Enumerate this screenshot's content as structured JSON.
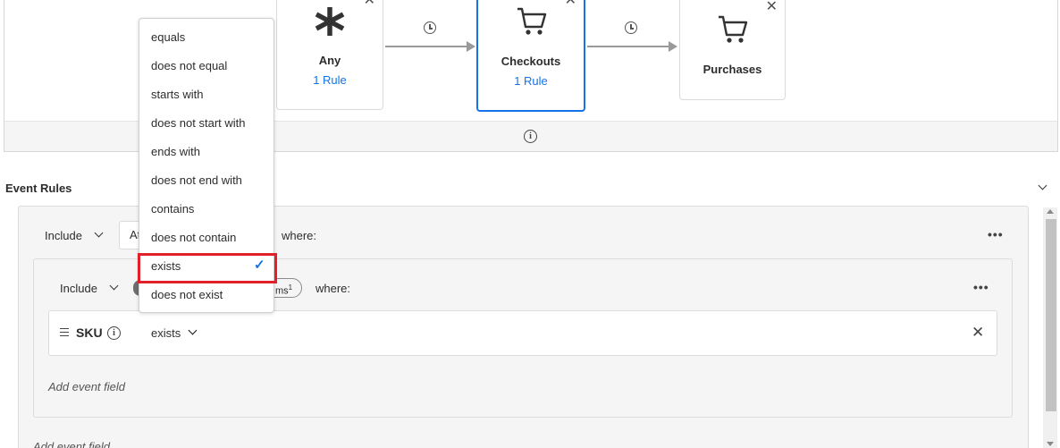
{
  "flow": {
    "nodes": [
      {
        "title": "Any",
        "rule": "1 Rule",
        "icon": "asterisk-icon"
      },
      {
        "title": "Checkouts",
        "rule": "1 Rule",
        "icon": "cart-icon",
        "selected": true
      },
      {
        "title": "Purchases",
        "icon": "cart-icon"
      }
    ],
    "close_glyph": "✕",
    "info_glyph": "i"
  },
  "event_rules": {
    "title": "Event Rules",
    "outer": {
      "include": "Include",
      "partial": "At",
      "where": "where:"
    },
    "inner": {
      "include": "Include",
      "partial_badge": "ms",
      "badge_sup": "1",
      "where": "where:"
    },
    "sku": {
      "label": "SKU",
      "operator": "exists"
    },
    "add_event_field": "Add event field",
    "add_event_field_bottom": "Add event field"
  },
  "operator_menu": {
    "items": [
      {
        "label": "equals"
      },
      {
        "label": "does not equal"
      },
      {
        "label": "starts with"
      },
      {
        "label": "does not start with"
      },
      {
        "label": "ends with"
      },
      {
        "label": "does not end with"
      },
      {
        "label": "contains"
      },
      {
        "label": "does not contain"
      },
      {
        "label": "exists",
        "selected": true
      },
      {
        "label": "does not exist"
      }
    ],
    "check_glyph": "✓"
  },
  "colors": {
    "accent": "#1473e6",
    "highlight": "#e0212c"
  }
}
